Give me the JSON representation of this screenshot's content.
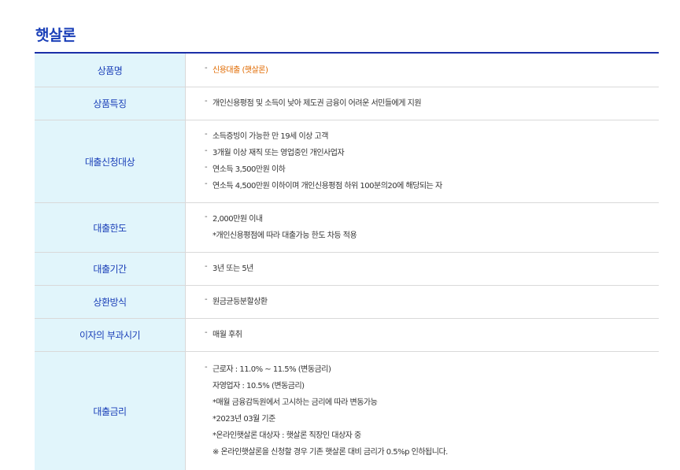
{
  "page_title": "햇살론",
  "rows": [
    {
      "label": "상품명",
      "lines": [
        {
          "text": "신용대출 (햇살론)",
          "bullet": true,
          "accent": true
        }
      ]
    },
    {
      "label": "상품특징",
      "lines": [
        {
          "text": "개인신용평점 및 소득이 낮아 제도권 금융이 어려운 서민들에게 지원",
          "bullet": true
        }
      ]
    },
    {
      "label": "대출신청대상",
      "lines": [
        {
          "text": "소득증빙이 가능한 만 19세 이상 고객",
          "bullet": true
        },
        {
          "text": "3개월 이상 재직 또는 영업중인 개인사업자",
          "bullet": true
        },
        {
          "text": "연소득 3,500만원 이하",
          "bullet": true
        },
        {
          "text": "연소득 4,500만원 이하이며 개인신용평점 하위 100분의20에 해당되는 자",
          "bullet": true
        }
      ]
    },
    {
      "label": "대출한도",
      "lines": [
        {
          "text": "2,000만원 이내",
          "bullet": true
        },
        {
          "text": "*개인신용평점에 따라 대출가능 한도 차등 적용",
          "bullet": false
        }
      ]
    },
    {
      "label": "대출기간",
      "lines": [
        {
          "text": "3년 또는 5년",
          "bullet": true
        }
      ]
    },
    {
      "label": "상환방식",
      "lines": [
        {
          "text": "원금균등분할상환",
          "bullet": true
        }
      ]
    },
    {
      "label": "이자의 부과시기",
      "lines": [
        {
          "text": "매월 후취",
          "bullet": true
        }
      ]
    },
    {
      "label": "대출금리",
      "lines": [
        {
          "text": "근로자 : 11.0% ~ 11.5% (변동금리)",
          "bullet": true
        },
        {
          "text": "자영업자 : 10.5% (변동금리)",
          "bullet": false
        },
        {
          "text": "*매월 금융감독원에서 고시하는 금리에 따라 변동가능",
          "bullet": false
        },
        {
          "text": "*2023년 03월 기준",
          "bullet": false
        },
        {
          "text": "*온라인햇살론 대상자 : 햇살론 직장인 대상자 중",
          "bullet": false
        },
        {
          "text": "※ 온라인햇살론을 신청할 경우 기존 햇살론 대비 금리가 0.5%p 인하됩니다.",
          "bullet": false
        }
      ]
    }
  ]
}
